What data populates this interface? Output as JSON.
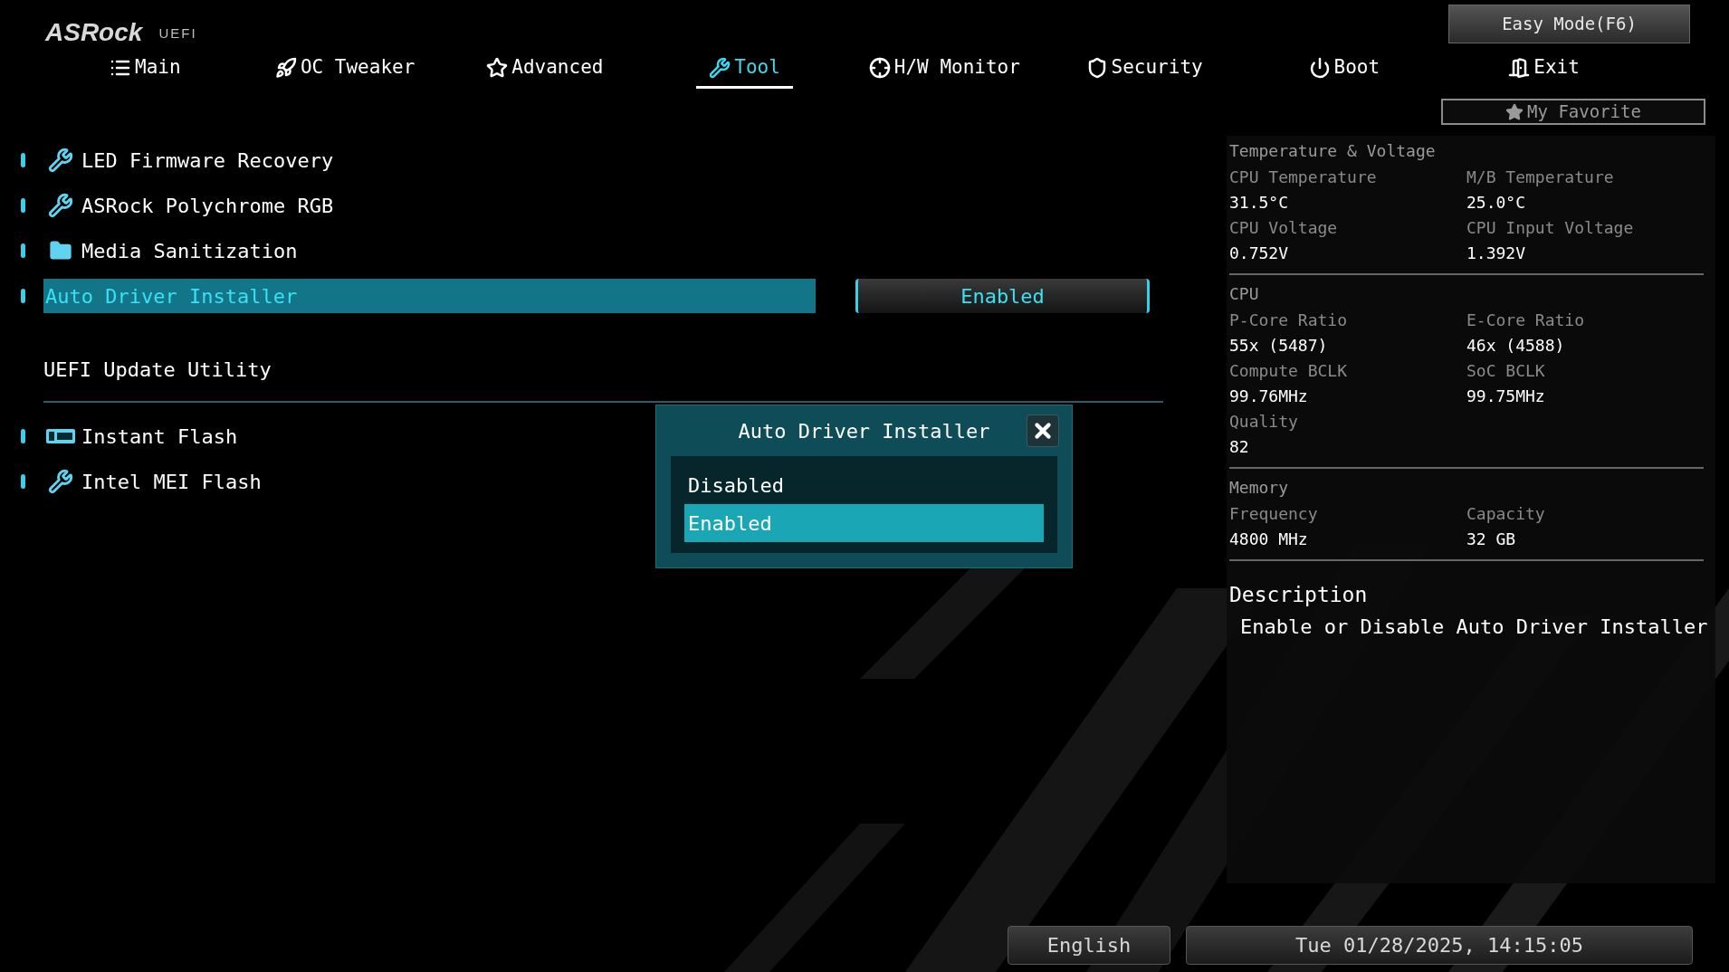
{
  "header": {
    "logo": "ASRock",
    "logo_sub": "UEFI",
    "easy_mode_button": "Easy Mode(F6)",
    "favorite_button": "My Favorite"
  },
  "tabs": [
    {
      "label": "Main",
      "selected": false
    },
    {
      "label": "OC Tweaker",
      "selected": false
    },
    {
      "label": "Advanced",
      "selected": false
    },
    {
      "label": "Tool",
      "selected": true
    },
    {
      "label": "H/W Monitor",
      "selected": false
    },
    {
      "label": "Security",
      "selected": false
    },
    {
      "label": "Boot",
      "selected": false
    },
    {
      "label": "Exit",
      "selected": false
    }
  ],
  "menu": {
    "items": [
      {
        "label": "LED Firmware Recovery",
        "kind": "wrench",
        "selected": false
      },
      {
        "label": "ASRock Polychrome RGB",
        "kind": "wrench",
        "selected": false
      },
      {
        "label": "Media Sanitization",
        "kind": "folder",
        "selected": false
      },
      {
        "label": "Auto Driver Installer",
        "kind": "setting",
        "selected": true,
        "value": "Enabled"
      }
    ],
    "section": {
      "title": "UEFI Update Utility",
      "items": [
        {
          "label": "Instant Flash",
          "kind": "bios",
          "selected": false
        },
        {
          "label": "Intel MEI Flash",
          "kind": "wrench",
          "selected": false
        }
      ]
    }
  },
  "popup": {
    "title": "Auto Driver Installer",
    "options": [
      {
        "label": "Disabled",
        "selected": false
      },
      {
        "label": "Enabled",
        "selected": true
      }
    ]
  },
  "hardware_panel": {
    "groups": [
      {
        "title": "Temperature & Voltage",
        "fields": [
          {
            "label": "CPU Temperature",
            "value": "31.5°C"
          },
          {
            "label": "M/B Temperature",
            "value": "25.0°C"
          },
          {
            "label": "CPU Voltage",
            "value": "0.752V"
          },
          {
            "label": "CPU Input Voltage",
            "value": "1.392V"
          }
        ]
      },
      {
        "title": "CPU",
        "fields": [
          {
            "label": "P-Core Ratio",
            "value": "55x (5487)"
          },
          {
            "label": "E-Core Ratio",
            "value": "46x (4588)"
          },
          {
            "label": "Compute BCLK",
            "value": "99.76MHz"
          },
          {
            "label": "SoC BCLK",
            "value": "99.75MHz"
          },
          {
            "label": "Quality",
            "value": "82"
          }
        ]
      },
      {
        "title": "Memory",
        "fields": [
          {
            "label": "Frequency",
            "value": "4800 MHz"
          },
          {
            "label": "Capacity",
            "value": "32 GB"
          }
        ]
      }
    ]
  },
  "description": {
    "title": "Description",
    "text": "Enable or Disable Auto Driver Installer"
  },
  "footer": {
    "language": "English",
    "datetime": "Tue 01/28/2025, 14:15:05"
  }
}
